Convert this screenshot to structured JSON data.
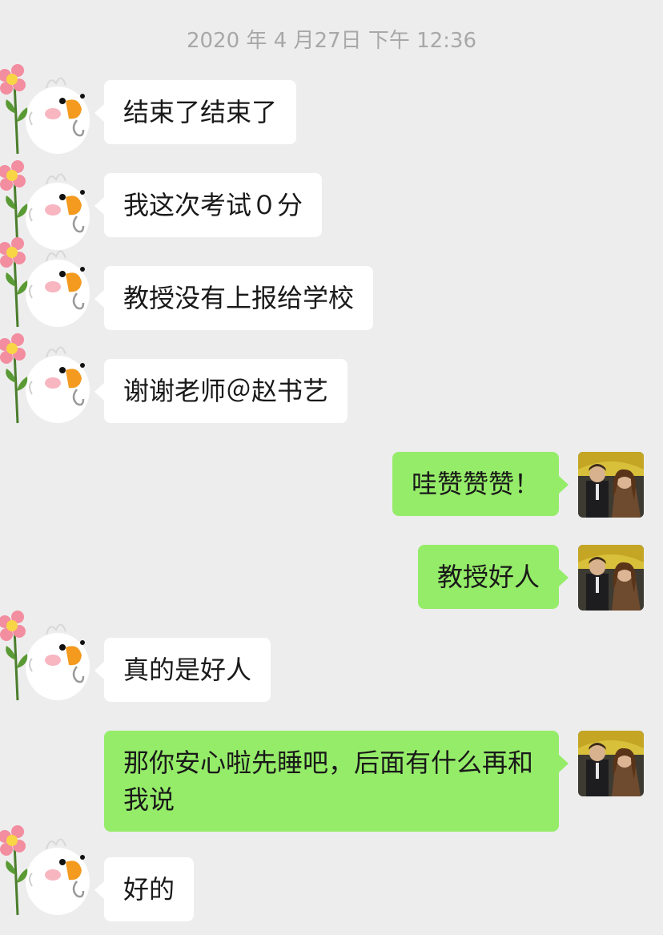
{
  "timestamp": "2020 年 4 月27日 下午 12:36",
  "colors": {
    "background": "#ededed",
    "incoming_bubble": "#ffffff",
    "outgoing_bubble": "#95ec69",
    "text": "#191919",
    "timestamp": "#a8a8a8"
  },
  "avatars": {
    "incoming": "cartoon-duck-with-flower-icon",
    "outgoing": "couple-photo"
  },
  "messages": [
    {
      "direction": "in",
      "text": "结束了结束了"
    },
    {
      "direction": "in",
      "text": "我这次考试０分"
    },
    {
      "direction": "in",
      "text": "教授没有上报给学校"
    },
    {
      "direction": "in",
      "text": "谢谢老师＠赵书艺"
    },
    {
      "direction": "out",
      "text": "哇赞赞赞！"
    },
    {
      "direction": "out",
      "text": "教授好人"
    },
    {
      "direction": "in",
      "text": "真的是好人"
    },
    {
      "direction": "out",
      "text": "那你安心啦先睡吧，后面有什么再和我说"
    },
    {
      "direction": "in",
      "text": "好的"
    }
  ]
}
